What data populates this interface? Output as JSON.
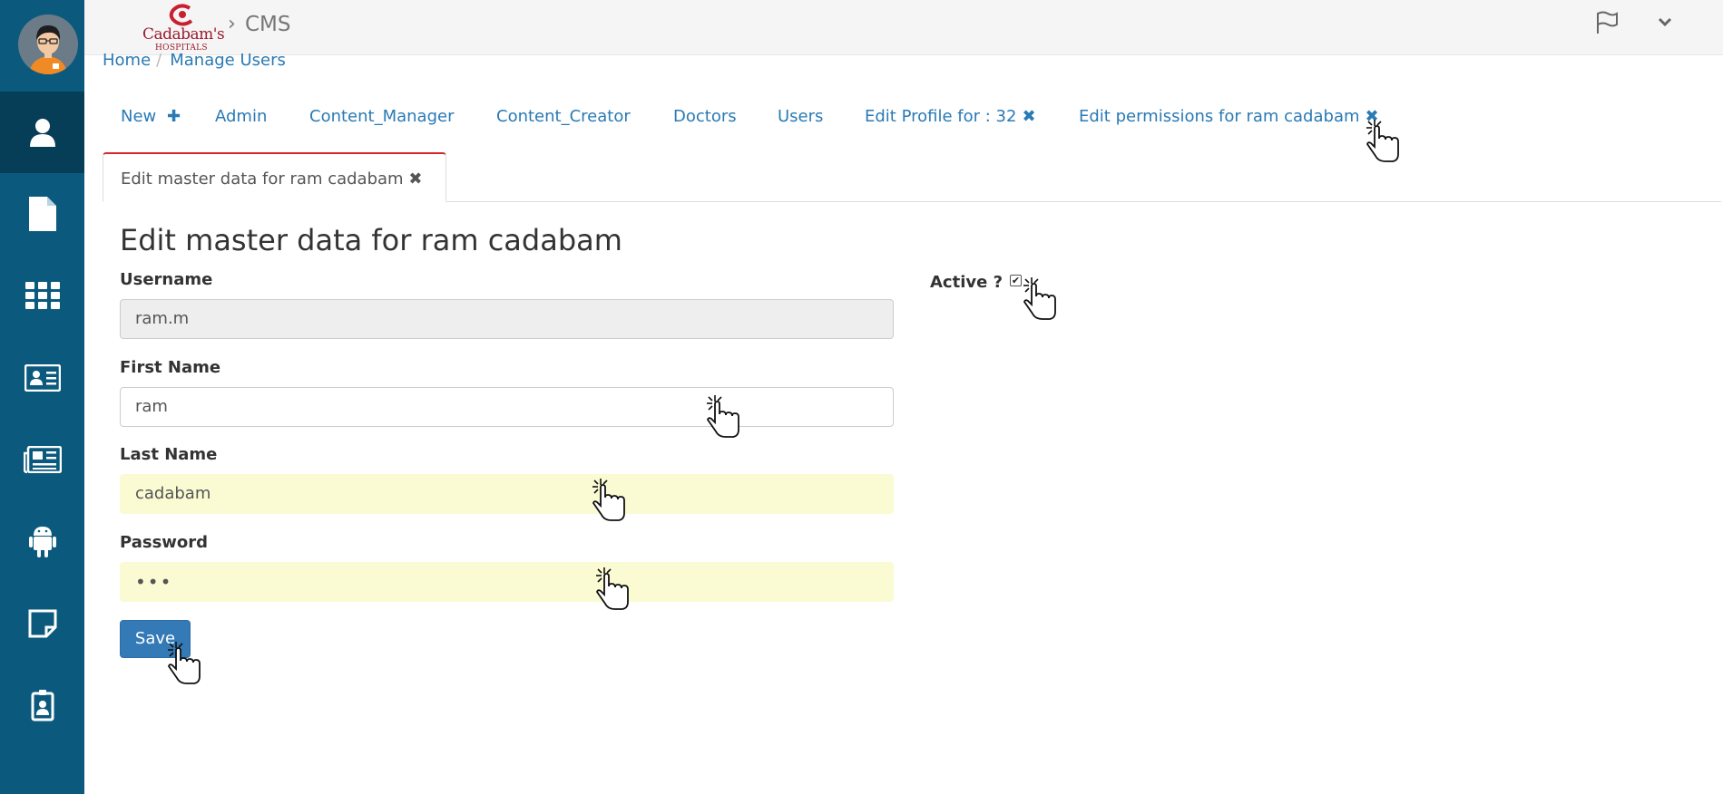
{
  "sidebar": {
    "items": [
      {
        "icon": "user-icon",
        "active": true
      },
      {
        "icon": "file-icon",
        "active": false
      },
      {
        "icon": "grid-icon",
        "active": false
      },
      {
        "icon": "id-card-icon",
        "active": false
      },
      {
        "icon": "newspaper-icon",
        "active": false
      },
      {
        "icon": "android-icon",
        "active": false
      },
      {
        "icon": "sticky-note-icon",
        "active": false
      },
      {
        "icon": "badge-icon",
        "active": false
      }
    ]
  },
  "header": {
    "logo_text": "Cadabam's",
    "logo_subtext": "HOSPITALS",
    "app_title": "CMS",
    "icons": [
      "flag-icon",
      "chevron-down-icon"
    ]
  },
  "breadcrumb": {
    "home": "Home",
    "current": "Manage Users"
  },
  "tabs": {
    "items": [
      {
        "label": "New",
        "suffix": "✚"
      },
      {
        "label": "Admin"
      },
      {
        "label": "Content_Manager"
      },
      {
        "label": "Content_Creator"
      },
      {
        "label": "Doctors"
      },
      {
        "label": "Users"
      },
      {
        "label": "Edit Profile for : 32",
        "suffix": "✖"
      },
      {
        "label": "Edit permissions for ram cadabam",
        "suffix": "✖"
      }
    ],
    "active": {
      "label": "Edit master data for ram cadabam",
      "suffix": "✖"
    }
  },
  "form": {
    "title": "Edit master data for ram cadabam",
    "username_label": "Username",
    "username_value": "ram.m",
    "first_name_label": "First Name",
    "first_name_value": "ram",
    "last_name_label": "Last Name",
    "last_name_value": "cadabam",
    "password_label": "Password",
    "password_value": "•••",
    "active_label": "Active ?",
    "active_checked": true,
    "save_label": "Save"
  },
  "colors": {
    "sidebar_bg": "#0b5a7e",
    "sidebar_active": "#063e57",
    "link": "#2a7ab5",
    "active_tab_border": "#d7262c",
    "autofill_bg": "#fafbd2",
    "primary_button": "#337ab7"
  }
}
